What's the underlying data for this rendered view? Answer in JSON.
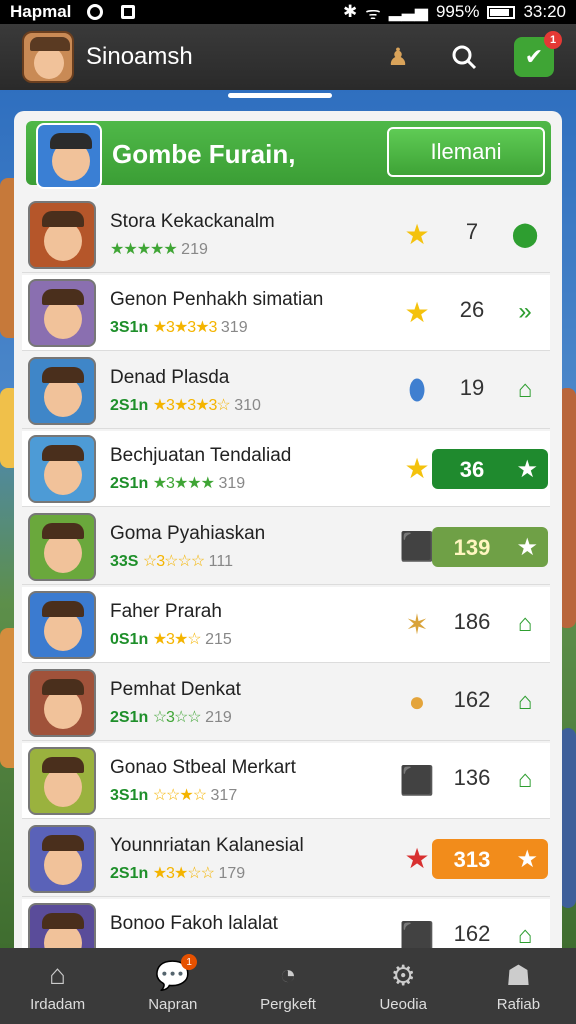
{
  "status_bar": {
    "carrier": "Hapmal",
    "battery": "995%",
    "time": "33:20"
  },
  "topbar": {
    "title": "Sinoamsh",
    "notification_count": "1",
    "icons": [
      "avatar",
      "people-icon",
      "search-icon",
      "check-icon"
    ]
  },
  "card": {
    "title": "Gombe Furain,",
    "button_label": "Ilemani"
  },
  "rows": [
    {
      "name": "Stora Kekackanalm",
      "level": "",
      "stars": "★★★★★",
      "tail": "",
      "num": "219",
      "icon": "star",
      "value": "7",
      "action": "bag"
    },
    {
      "name": "Genon Penhakh simatian",
      "level": "3S1n",
      "stars": "★3★3★3",
      "tail": "",
      "num": "319",
      "icon": "star",
      "value": "26",
      "action": "arrow"
    },
    {
      "name": "Denad Plasda",
      "level": "2S1n",
      "stars": "★3★3★3☆",
      "tail": "",
      "num": "310",
      "icon": "shield",
      "value": "19",
      "action": "home"
    },
    {
      "name": "Bechjuatan Tendaliad",
      "level": "2S1n",
      "stars": "★3★★★",
      "tail": "",
      "num": "319",
      "icon": "star",
      "value": "36",
      "action": "star"
    },
    {
      "name": "Goma Pyahiaskan",
      "level": "33S",
      "stars": "☆3☆☆☆",
      "tail": "",
      "num": "111",
      "icon": "bag",
      "value": "139",
      "action": "star"
    },
    {
      "name": "Faher Prarah",
      "level": "0S1n",
      "stars": "★3★☆",
      "tail": "",
      "num": "215",
      "icon": "badge",
      "value": "186",
      "action": "home"
    },
    {
      "name": "Pemhat Denkat",
      "level": "2S1n",
      "stars": "☆3☆☆",
      "tail": "",
      "num": "219",
      "icon": "face",
      "value": "162",
      "action": "home"
    },
    {
      "name": "Gonao Stbeal Merkart",
      "level": "3S1n",
      "stars": "☆☆★☆",
      "tail": "",
      "num": "317",
      "icon": "bag",
      "value": "136",
      "action": "home"
    },
    {
      "name": "Younnriatan Kalanesial",
      "level": "2S1n",
      "stars": "★3★☆☆",
      "tail": "",
      "num": "179",
      "icon": "redstar",
      "value": "313",
      "action": "star"
    },
    {
      "name": "Bonoo Fakoh lalalat",
      "level": "",
      "stars": "",
      "tail": "",
      "num": "",
      "icon": "bag",
      "value": "162",
      "action": "home"
    }
  ],
  "nav": {
    "items": [
      {
        "label": "Irdadam",
        "icon": "home-icon"
      },
      {
        "label": "Napran",
        "icon": "chat-icon",
        "badge": "1"
      },
      {
        "label": "Pergkeft",
        "icon": "gauge-icon"
      },
      {
        "label": "Ueodia",
        "icon": "gear-icon"
      },
      {
        "label": "Rafiab",
        "icon": "controller-icon"
      }
    ]
  },
  "colors": {
    "accent_green": "#3fa535",
    "highlight_dark_green": "#1f8a2e",
    "highlight_olive": "#6fa046",
    "highlight_orange": "#f28c1b"
  }
}
